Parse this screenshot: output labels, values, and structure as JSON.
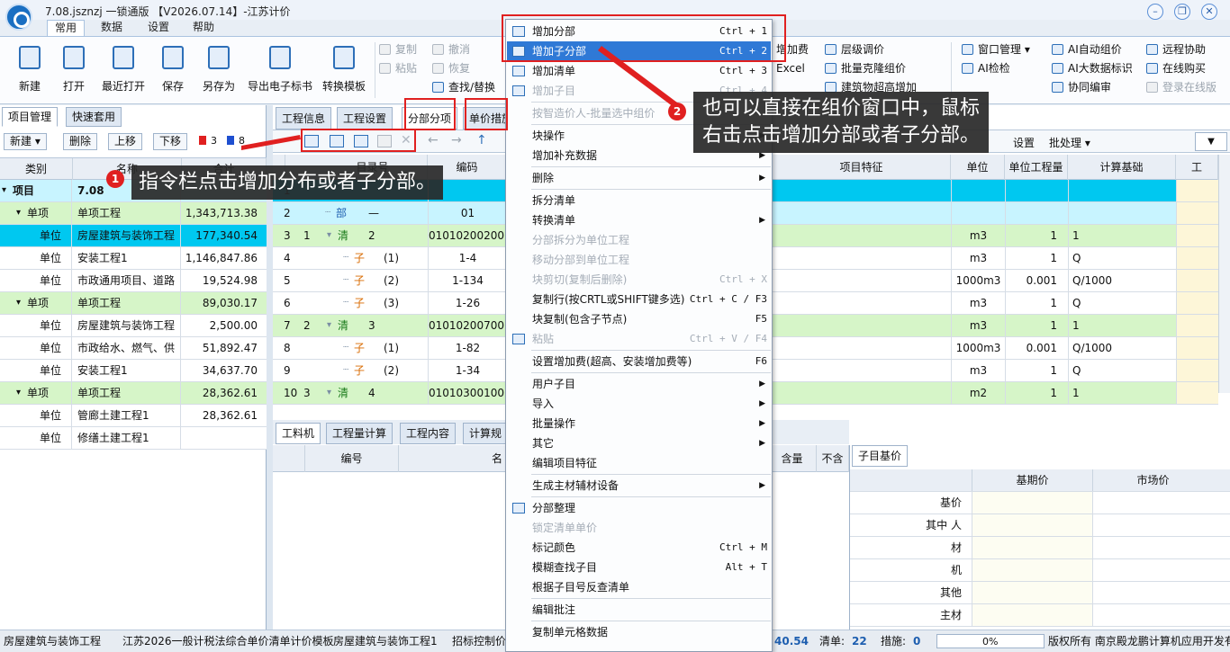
{
  "window": {
    "title": "7.08.jsznzj 一锁通版 【V2026.07.14】-江苏计价"
  },
  "menu_tabs": [
    "常用",
    "数据",
    "设置",
    "帮助"
  ],
  "ribbon": {
    "big_buttons": [
      "新建",
      "打开",
      "最近打开",
      "保存",
      "另存为",
      "导出电子标书",
      "转换模板"
    ],
    "small_buttons": {
      "copy": "复制",
      "paste": "粘贴",
      "undo": "撤消",
      "redo": "恢复",
      "find_replace": "查找/替换",
      "add_fee": "增加费",
      "excel": "Excel",
      "level_adjust": "层级调价",
      "batch_clone": "批量克隆组价",
      "building_height": "建筑物超高增加",
      "window_mgmt": "窗口管理",
      "ai_check": "AI检检",
      "ai_auto_price": "AI自动组价",
      "ai_big_data": "AI大数据标识",
      "collab_edit": "协同编审",
      "remote_help": "远程协助",
      "online_buy": "在线购买",
      "login_online": "登录在线版"
    }
  },
  "left_panel": {
    "tabs": [
      "项目管理",
      "快速套用"
    ],
    "buttons": [
      "新建",
      "删除",
      "上移",
      "下移"
    ],
    "flag_red_count": "3",
    "flag_blue_count": "8",
    "headers": [
      "类别",
      "名称",
      "合计"
    ],
    "rows": [
      {
        "type": "项目",
        "name": "7.08",
        "total": ""
      },
      {
        "type": "单项",
        "name": "单项工程",
        "total": "1,343,713.38"
      },
      {
        "type": "单位",
        "name": "房屋建筑与装饰工程",
        "total": "177,340.54"
      },
      {
        "type": "单位",
        "name": "安装工程1",
        "total": "1,146,847.86"
      },
      {
        "type": "单位",
        "name": "市政通用项目、道路",
        "total": "19,524.98"
      },
      {
        "type": "单项",
        "name": "单项工程",
        "total": "89,030.17"
      },
      {
        "type": "单位",
        "name": "房屋建筑与装饰工程",
        "total": "2,500.00"
      },
      {
        "type": "单位",
        "name": "市政给水、燃气、供",
        "total": "51,892.47"
      },
      {
        "type": "单位",
        "name": "安装工程1",
        "total": "34,637.70"
      },
      {
        "type": "单项",
        "name": "单项工程",
        "total": "28,362.61"
      },
      {
        "type": "单位",
        "name": "管廊土建工程1",
        "total": "28,362.61"
      },
      {
        "type": "单位",
        "name": "修缮土建工程1",
        "total": ""
      }
    ]
  },
  "main": {
    "tabs": [
      "工程信息",
      "工程设置",
      "分部分项",
      "单价措施"
    ],
    "toolbar_right": {
      "settings": "设置",
      "batch": "批处理"
    },
    "headers": [
      "",
      "",
      "目录号",
      "编码",
      "项目特征",
      "单位",
      "单位工程量",
      "计算基础",
      "工"
    ],
    "rows": [
      {
        "n": "1",
        "s": "",
        "cat": "",
        "code": "",
        "unit": "",
        "qty": "",
        "base": ""
      },
      {
        "n": "2",
        "s": "",
        "cat": "部",
        "sub": "—",
        "code": "01",
        "unit": "",
        "qty": "",
        "base": ""
      },
      {
        "n": "3",
        "s": "1",
        "cat": "清",
        "sub": "2",
        "code": "010102002001",
        "unit": "m3",
        "qty": "1",
        "base": "1"
      },
      {
        "n": "4",
        "s": "",
        "cat": "子",
        "sub": "(1)",
        "code": "1-4",
        "unit": "m3",
        "qty": "1",
        "base": "Q"
      },
      {
        "n": "5",
        "s": "",
        "cat": "子",
        "sub": "(2)",
        "code": "1-134",
        "unit": "1000m3",
        "qty": "0.001",
        "base": "Q/1000"
      },
      {
        "n": "6",
        "s": "",
        "cat": "子",
        "sub": "(3)",
        "code": "1-26",
        "unit": "m3",
        "qty": "1",
        "base": "Q"
      },
      {
        "n": "7",
        "s": "2",
        "cat": "清",
        "sub": "3",
        "code": "010102007001",
        "unit": "m3",
        "qty": "1",
        "base": "1"
      },
      {
        "n": "8",
        "s": "",
        "cat": "子",
        "sub": "(1)",
        "code": "1-82",
        "unit": "1000m3",
        "qty": "0.001",
        "base": "Q/1000"
      },
      {
        "n": "9",
        "s": "",
        "cat": "子",
        "sub": "(2)",
        "code": "1-34",
        "unit": "m3",
        "qty": "1",
        "base": "Q"
      },
      {
        "n": "10",
        "s": "3",
        "cat": "清",
        "sub": "4",
        "code": "010103001001",
        "unit": "m2",
        "qty": "1",
        "base": "1"
      }
    ]
  },
  "bottom": {
    "tabs": [
      "工料机",
      "工程量计算",
      "工程内容",
      "计算规"
    ],
    "headers": [
      "编号",
      "名",
      "含量",
      "不含"
    ],
    "sub_tab": "子目基价",
    "sub_headers": [
      "基期价",
      "市场价"
    ],
    "sub_rows": [
      "基价",
      "其中 人",
      "材",
      "机",
      "其他",
      "主材"
    ]
  },
  "statusbar": {
    "item1": "房屋建筑与装饰工程",
    "item2": "江苏2026一般计税法综合单价清单计价模板",
    "item3": "房屋建筑与装饰工程1",
    "item4": "招标控制价",
    "total": "40.54",
    "qd_label": "清单:",
    "qd_val": "22",
    "cs_label": "措施:",
    "cs_val": "0",
    "progress": "0%",
    "copyright": "版权所有 南京殿龙鹏计算机应用开发有限公司"
  },
  "context_menu": [
    {
      "label": "增加分部",
      "sc": "Ctrl + 1",
      "icon": true
    },
    {
      "label": "增加子分部",
      "sc": "Ctrl + 2",
      "icon": true,
      "hl": true
    },
    {
      "label": "增加清单",
      "sc": "Ctrl + 3",
      "icon": true
    },
    {
      "label": "增加子目",
      "sc": "Ctrl + 4",
      "icon": true,
      "dis": true
    },
    {
      "sep": true
    },
    {
      "label": "按智造价人-批量选中组价",
      "dis": true
    },
    {
      "sep": true
    },
    {
      "label": "块操作",
      "arr": true
    },
    {
      "label": "增加补充数据",
      "arr": true
    },
    {
      "sep": true
    },
    {
      "label": "删除",
      "arr": true
    },
    {
      "sep": true
    },
    {
      "label": "拆分清单"
    },
    {
      "label": "转换清单",
      "arr": true
    },
    {
      "label": "分部拆分为单位工程",
      "dis": true
    },
    {
      "label": "移动分部到单位工程",
      "dis": true
    },
    {
      "label": "块剪切(复制后删除)",
      "sc": "Ctrl + X",
      "dis": true
    },
    {
      "label": "复制行(按CRTL或SHIFT键多选)",
      "sc": "Ctrl + C / F3"
    },
    {
      "label": "块复制(包含子节点)",
      "sc": "F5"
    },
    {
      "label": "粘贴",
      "sc": "Ctrl + V / F4",
      "dis": true,
      "icon": true
    },
    {
      "sep": true
    },
    {
      "label": "设置增加费(超高、安装增加费等)",
      "sc": "F6"
    },
    {
      "sep": true
    },
    {
      "label": "用户子目",
      "arr": true
    },
    {
      "label": "导入",
      "arr": true
    },
    {
      "label": "批量操作",
      "arr": true
    },
    {
      "label": "其它",
      "arr": true
    },
    {
      "label": "编辑项目特征"
    },
    {
      "sep": true
    },
    {
      "label": "生成主材辅材设备",
      "arr": true
    },
    {
      "sep": true
    },
    {
      "label": "分部整理",
      "icon": true
    },
    {
      "label": "锁定清单单价",
      "dis": true
    },
    {
      "label": "标记颜色",
      "sc": "Ctrl + M"
    },
    {
      "label": "模糊查找子目",
      "sc": "Alt + T"
    },
    {
      "label": "根据子目号反查清单"
    },
    {
      "sep": true
    },
    {
      "label": "编辑批注"
    },
    {
      "sep": true
    },
    {
      "label": "复制单元格数据"
    }
  ],
  "annotations": {
    "badge1": "1",
    "callout1": "指令栏点击增加分布或者子分部。",
    "badge2": "2",
    "callout2_line1": "也可以直接在组价窗口中，鼠标",
    "callout2_line2": "右击点击增加分部或者子分部。"
  },
  "colors": {
    "selected_row": "#00c8f0",
    "project_row": "#c8f4ff",
    "sub_row": "#d6f5c8",
    "menu_highlight": "#2f79d6",
    "annotation_red": "#e02020"
  }
}
